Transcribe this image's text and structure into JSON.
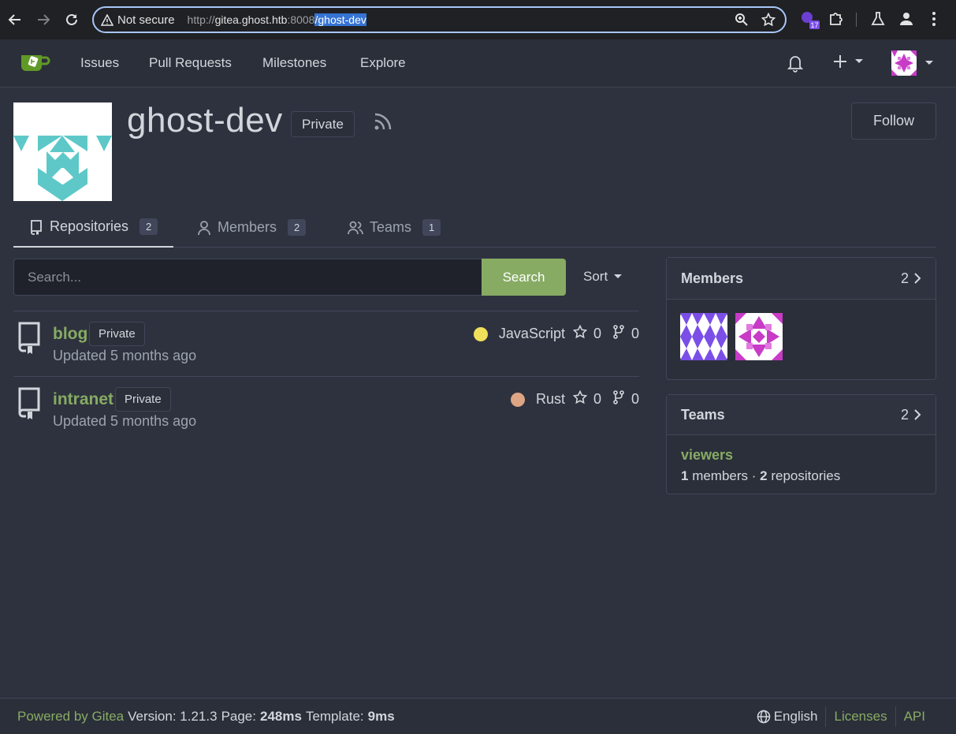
{
  "browser": {
    "security_label": "Not secure",
    "url_prefix": "http://",
    "url_host": "gitea.ghost.htb",
    "url_port": ":8008",
    "url_path": "/ghost-dev",
    "extension_badge": "17"
  },
  "nav": {
    "items": [
      "Issues",
      "Pull Requests",
      "Milestones",
      "Explore"
    ]
  },
  "org": {
    "name": "ghost-dev",
    "visibility": "Private",
    "follow_label": "Follow"
  },
  "tabs": [
    {
      "label": "Repositories",
      "count": "2"
    },
    {
      "label": "Members",
      "count": "2"
    },
    {
      "label": "Teams",
      "count": "1"
    }
  ],
  "search": {
    "placeholder": "Search...",
    "button_label": "Search",
    "sort_label": "Sort"
  },
  "repos": [
    {
      "name": "blog",
      "visibility": "Private",
      "updated": "Updated 5 months ago",
      "language": "JavaScript",
      "language_color": "#f1e05a",
      "stars": "0",
      "forks": "0"
    },
    {
      "name": "intranet",
      "visibility": "Private",
      "updated": "Updated 5 months ago",
      "language": "Rust",
      "language_color": "#dea584",
      "stars": "0",
      "forks": "0"
    }
  ],
  "sidebar": {
    "members_title": "Members",
    "members_count": "2",
    "teams_title": "Teams",
    "teams_count": "2",
    "team": {
      "name": "viewers",
      "members_num": "1",
      "members_text": " members · ",
      "repos_num": "2",
      "repos_text": " repositories"
    }
  },
  "footer": {
    "powered": "Powered by Gitea",
    "version": "Version: 1.21.3",
    "page_label": "Page:",
    "page_time": "248ms",
    "template_label": "Template:",
    "template_time": "9ms",
    "language": "English",
    "licenses": "Licenses",
    "api": "API"
  },
  "colors": {
    "accent": "#87ab63",
    "background": "#2e323e"
  }
}
